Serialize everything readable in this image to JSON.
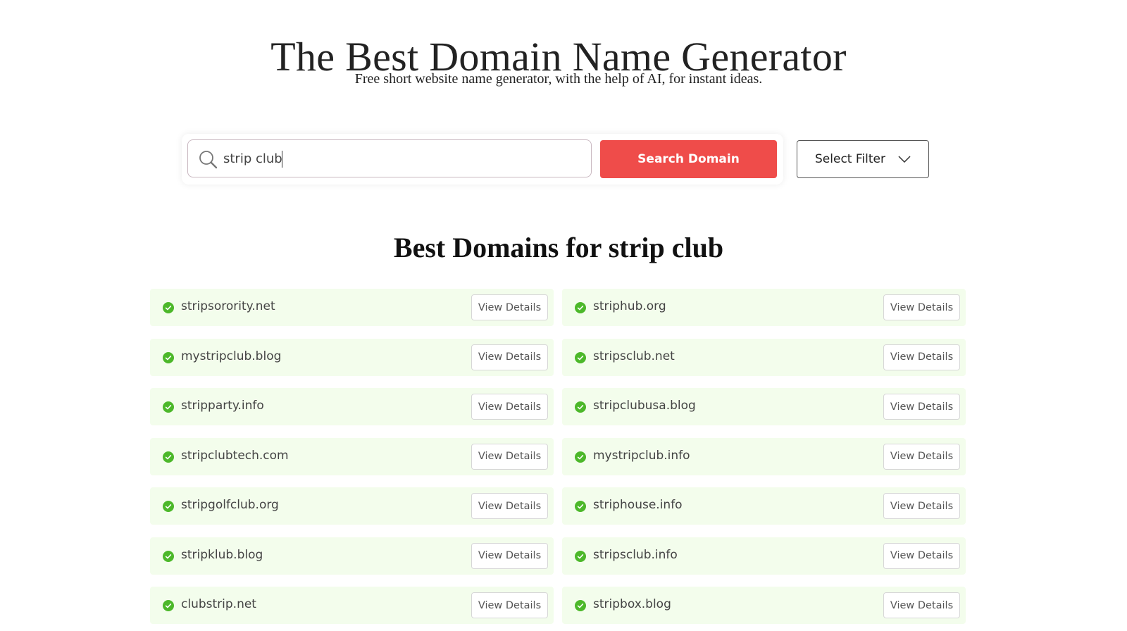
{
  "header": {
    "title": "The Best Domain Name Generator",
    "subtitle": "Free short website name generator, with the help of AI, for instant ideas."
  },
  "search": {
    "value": "strip club",
    "icon": "search-icon",
    "button_label": "Search Domain",
    "filter_label": "Select Filter",
    "filter_icon": "chevron-down-icon",
    "accent_color": "#ef4c4a"
  },
  "results": {
    "heading_prefix": "Best Domains for ",
    "heading_query": "strip club",
    "status_icon": "check-circle-icon",
    "status_color": "#4cb82a",
    "row_background": "#f3fdec",
    "button_label": "View Details",
    "items": [
      {
        "domain": "stripsorority.net"
      },
      {
        "domain": "striphub.org"
      },
      {
        "domain": "mystripclub.blog"
      },
      {
        "domain": "stripsclub.net"
      },
      {
        "domain": "stripparty.info"
      },
      {
        "domain": "stripclubusa.blog"
      },
      {
        "domain": "stripclubtech.com"
      },
      {
        "domain": "mystripclub.info"
      },
      {
        "domain": "stripgolfclub.org"
      },
      {
        "domain": "striphouse.info"
      },
      {
        "domain": "stripklub.blog"
      },
      {
        "domain": "stripsclub.info"
      },
      {
        "domain": "clubstrip.net"
      },
      {
        "domain": "stripbox.blog"
      }
    ]
  }
}
